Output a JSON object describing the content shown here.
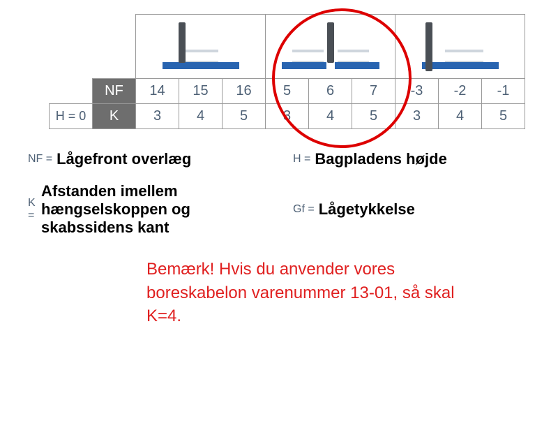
{
  "table": {
    "row_labels": {
      "h": "H = 0",
      "nf": "NF",
      "k": "K"
    },
    "nf_values": [
      "14",
      "15",
      "16",
      "5",
      "6",
      "7",
      "-3",
      "-2",
      "-1"
    ],
    "k_values": [
      "3",
      "4",
      "5",
      "3",
      "4",
      "5",
      "3",
      "4",
      "5"
    ]
  },
  "legend": {
    "nf_key": "NF =",
    "nf_value": "Lågefront overlæg",
    "h_key": "H =",
    "h_value": "Bagpladens højde",
    "k_key": "K =",
    "k_value": "Afstanden imellem hængselskoppen og skabssidens kant",
    "gf_key": "Gf =",
    "gf_value": "Lågetykkelse"
  },
  "notice": "Bemærk! Hvis du anvender vores boreskabelon varenummer 13-01, så skal K=4."
}
